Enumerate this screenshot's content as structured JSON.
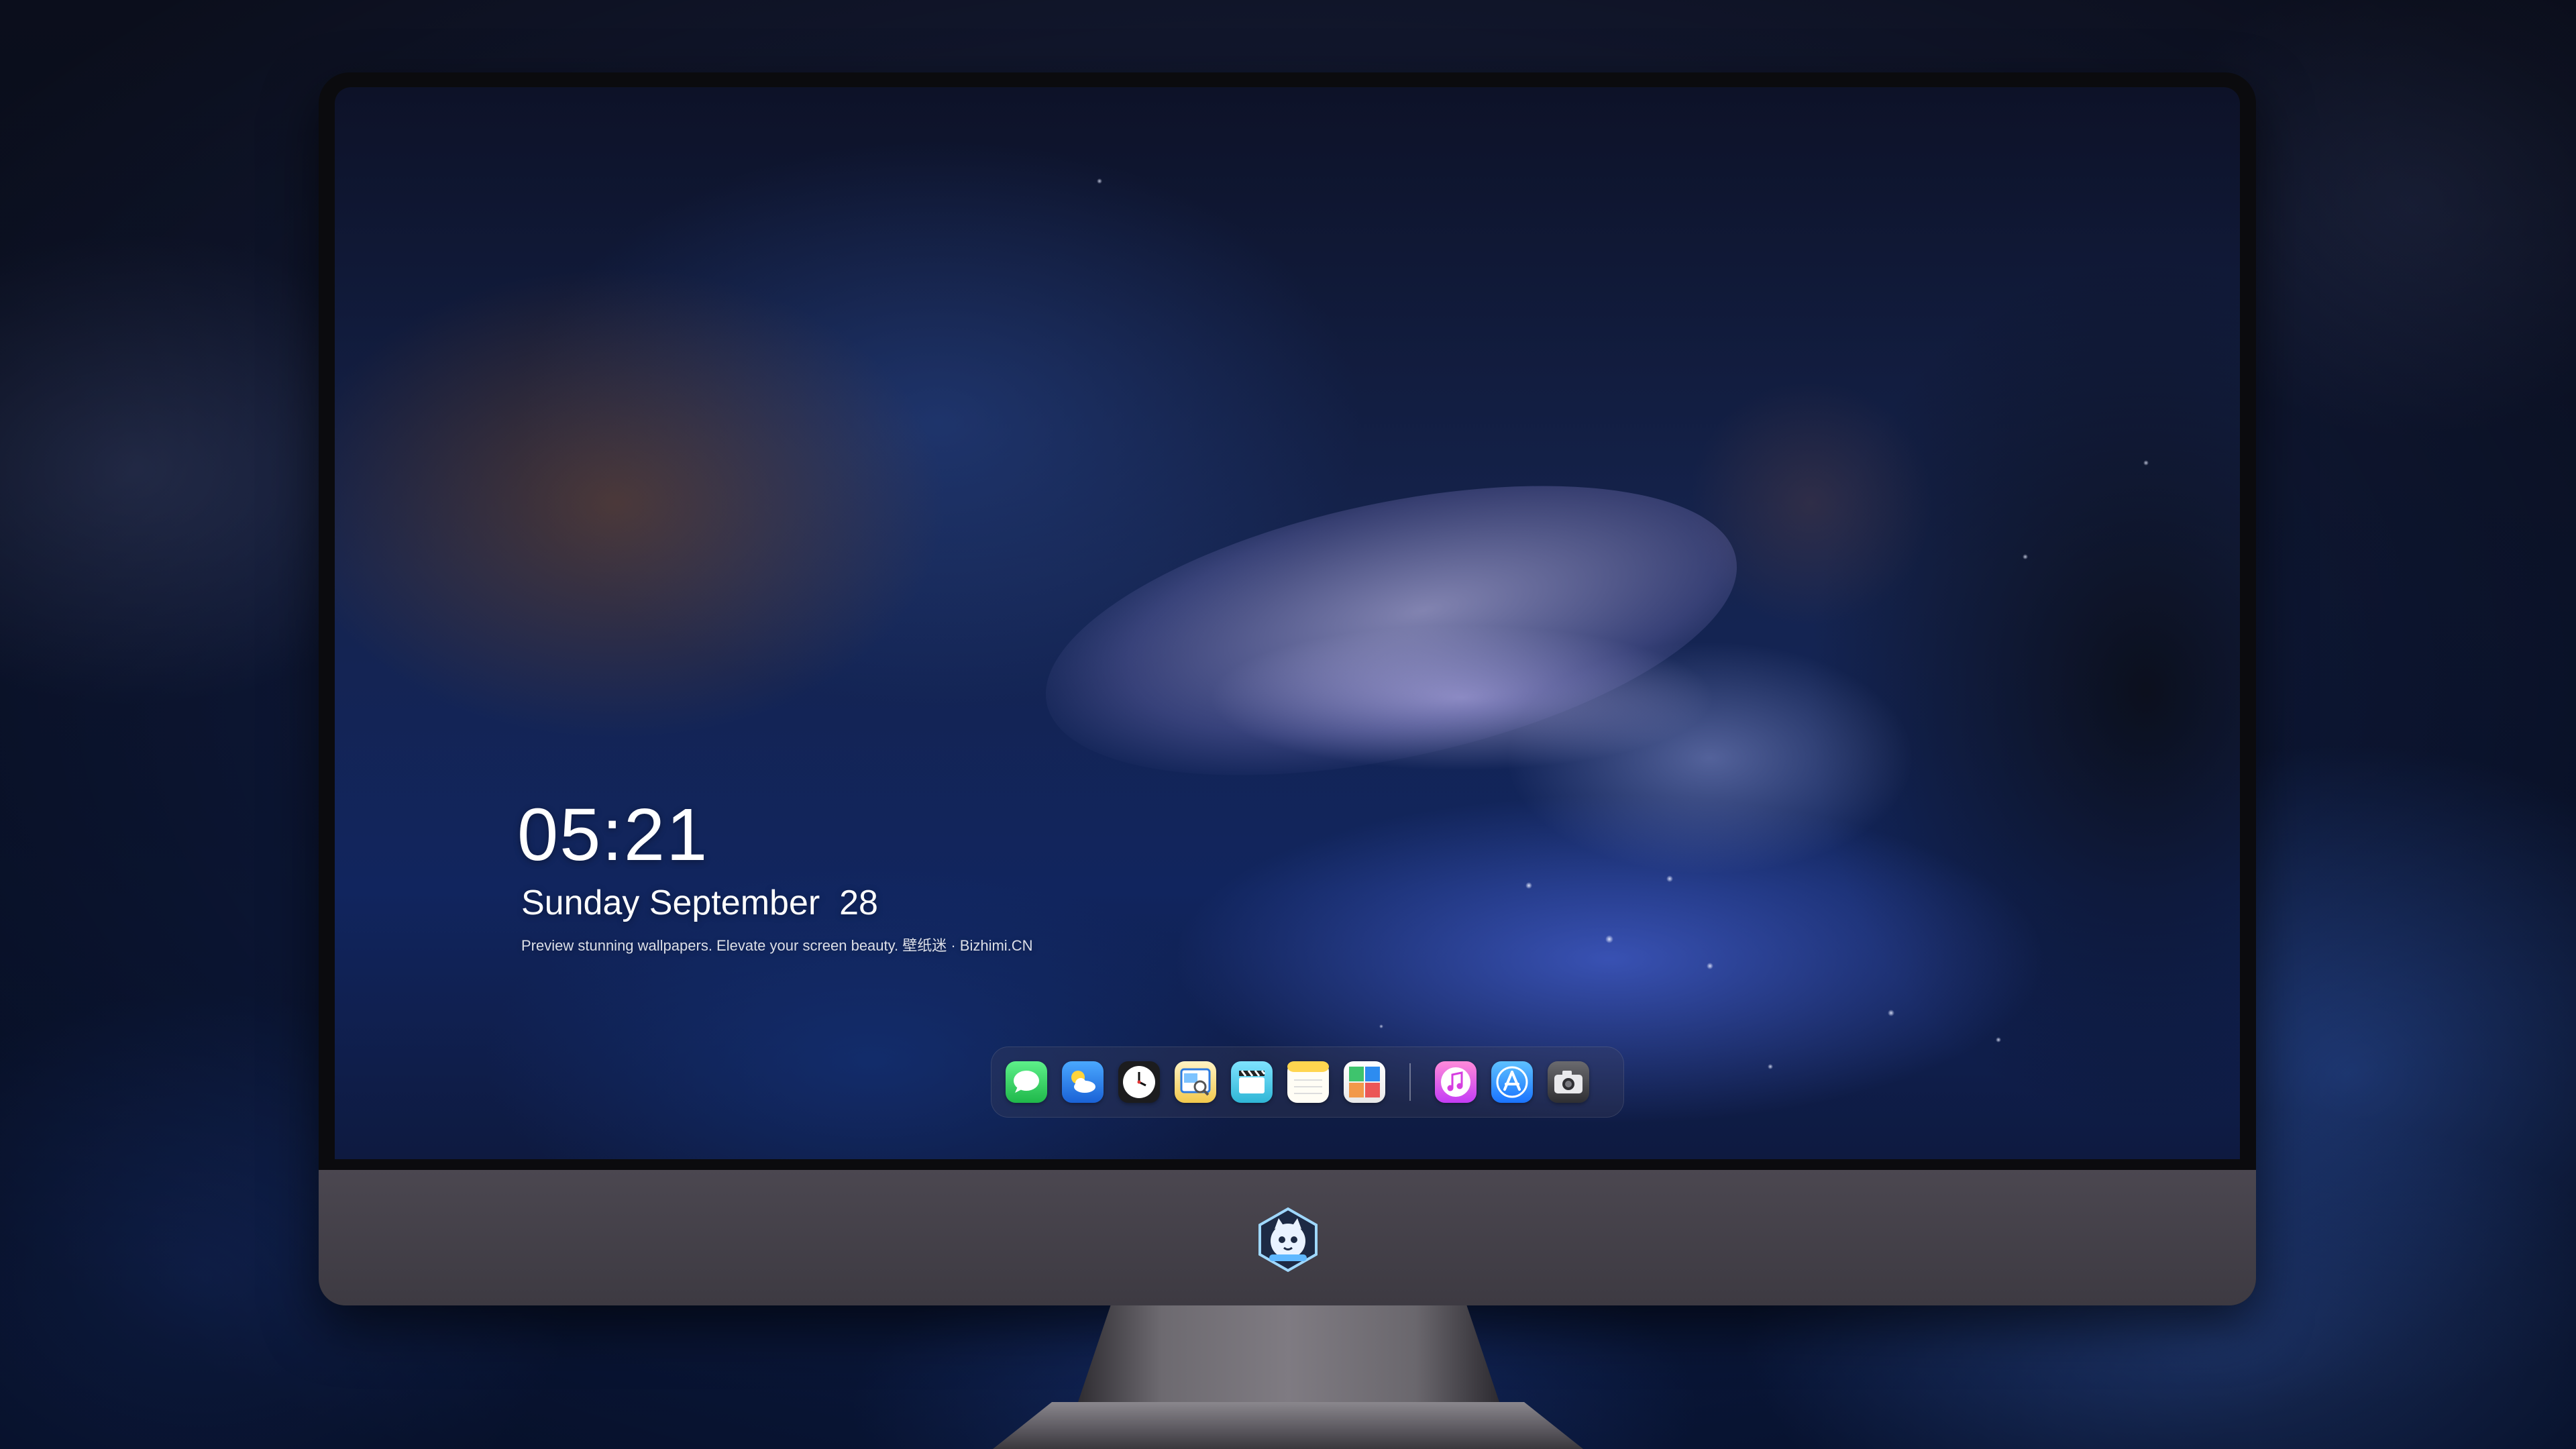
{
  "lock_screen": {
    "time": "05:21",
    "date": "Sunday September  28",
    "caption": "Preview stunning wallpapers. Elevate your screen beauty. 壁纸迷 · Bizhimi.CN"
  },
  "dock": {
    "apps": [
      {
        "icon": "messages-icon",
        "color": "#34c759"
      },
      {
        "icon": "weather-icon",
        "color": "#2d8cf0"
      },
      {
        "icon": "clock-icon",
        "color": "#1c1c1e"
      },
      {
        "icon": "preview-icon",
        "color": "#f2c94c"
      },
      {
        "icon": "clips-icon",
        "color": "#40c8e0"
      },
      {
        "icon": "notes-icon",
        "color": "#ffd54f"
      },
      {
        "icon": "photo-booth-icon",
        "color": "#3ec46d"
      },
      {
        "icon": "music-icon",
        "color": "#ff5ac8"
      },
      {
        "icon": "app-store-icon",
        "color": "#1a8cff"
      },
      {
        "icon": "camera-icon",
        "color": "#3a3a3c"
      }
    ]
  },
  "monitor": {
    "logo_icon": "cat-astronaut-logo-icon"
  }
}
